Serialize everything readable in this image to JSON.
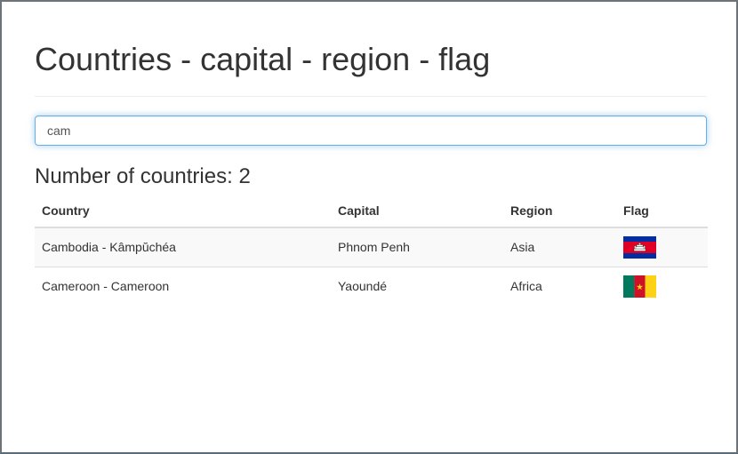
{
  "page": {
    "title": "Countries - capital - region - flag"
  },
  "search": {
    "value": "cam",
    "placeholder": ""
  },
  "summary": {
    "label": "Number of countries: ",
    "count": "2"
  },
  "table": {
    "headers": {
      "country": "Country",
      "capital": "Capital",
      "region": "Region",
      "flag": "Flag"
    },
    "rows": [
      {
        "country": "Cambodia - Kâmpŭchéa",
        "capital": "Phnom Penh",
        "region": "Asia",
        "flag_icon": "cambodia-flag-icon"
      },
      {
        "country": "Cameroon - Cameroon",
        "capital": "Yaoundé",
        "region": "Africa",
        "flag_icon": "cameroon-flag-icon"
      }
    ]
  },
  "colors": {
    "focus_border": "#66afe9",
    "stripe": "#f9f9f9",
    "text": "#333333"
  }
}
